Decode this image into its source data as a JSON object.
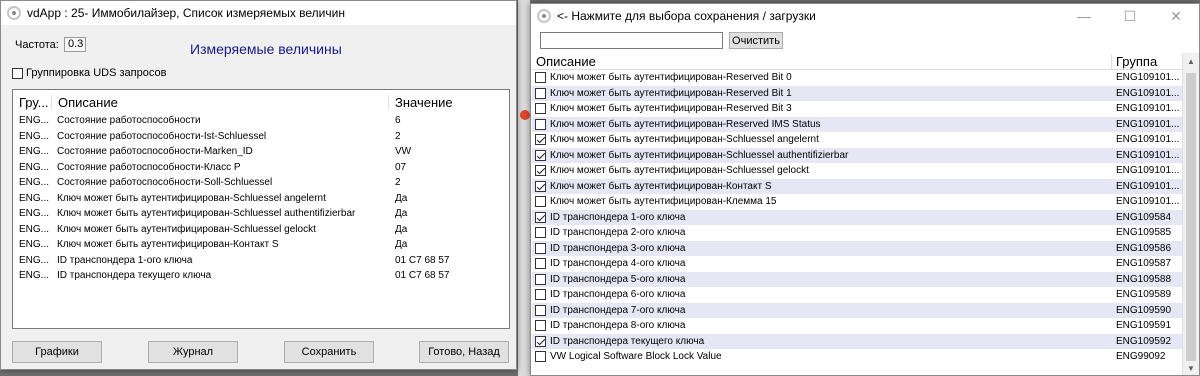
{
  "left_window": {
    "title": "vdApp : 25- Иммобилайзер,  Список измеряемых величин",
    "freq_label": "Частота:",
    "freq_value": "0.3",
    "main_title": "Измеряемые величины",
    "grouping_label": "Группировка UDS запросов",
    "grouping_checked": false,
    "columns": [
      "Гру...",
      "Описание",
      "Значение"
    ],
    "rows": [
      {
        "group": "ENG...",
        "desc": "Состояние работоспособности",
        "value": "6"
      },
      {
        "group": "ENG...",
        "desc": "Состояние работоспособности-Ist-Schluessel",
        "value": "2"
      },
      {
        "group": "ENG...",
        "desc": "Состояние работоспособности-Marken_ID",
        "value": "VW"
      },
      {
        "group": "ENG...",
        "desc": "Состояние работоспособности-Класс Р",
        "value": "07"
      },
      {
        "group": "ENG...",
        "desc": "Состояние работоспособности-Soll-Schluessel",
        "value": "2"
      },
      {
        "group": "ENG...",
        "desc": "Ключ может быть аутентифицирован-Schluessel angelernt",
        "value": "Да"
      },
      {
        "group": "ENG...",
        "desc": "Ключ может быть аутентифицирован-Schluessel authentifizierbar",
        "value": "Да"
      },
      {
        "group": "ENG...",
        "desc": "Ключ может быть аутентифицирован-Schluessel gelockt",
        "value": "Да"
      },
      {
        "group": "ENG...",
        "desc": "Ключ может быть аутентифицирован-Контакт S",
        "value": "Да"
      },
      {
        "group": "ENG...",
        "desc": "ID транспондера 1-ого ключа",
        "value": "01 C7 68 57"
      },
      {
        "group": "ENG...",
        "desc": "ID транспондера текущего ключа",
        "value": "01 C7 68 57"
      }
    ],
    "buttons": {
      "graphs": "Графики",
      "journal": "Журнал",
      "save": "Сохранить",
      "done": "Готово, Назад"
    }
  },
  "right_window": {
    "title": "<- Нажмите для выбора сохранения / загрузки",
    "search_placeholder": "",
    "clear_label": "Очистить",
    "columns": [
      "Описание",
      "Группа"
    ],
    "rows": [
      {
        "checked": false,
        "desc": "Ключ может быть аутентифицирован-Reserved Bit 0",
        "group": "ENG109101..."
      },
      {
        "checked": false,
        "desc": "Ключ может быть аутентифицирован-Reserved Bit 1",
        "group": "ENG109101..."
      },
      {
        "checked": false,
        "desc": "Ключ может быть аутентифицирован-Reserved Bit 3",
        "group": "ENG109101..."
      },
      {
        "checked": false,
        "desc": "Ключ может быть аутентифицирован-Reserved IMS Status",
        "group": "ENG109101..."
      },
      {
        "checked": true,
        "desc": "Ключ может быть аутентифицирован-Schluessel angelernt",
        "group": "ENG109101..."
      },
      {
        "checked": true,
        "desc": "Ключ может быть аутентифицирован-Schluessel authentifizierbar",
        "group": "ENG109101..."
      },
      {
        "checked": true,
        "desc": "Ключ может быть аутентифицирован-Schluessel gelockt",
        "group": "ENG109101..."
      },
      {
        "checked": true,
        "desc": "Ключ может быть аутентифицирован-Контакт S",
        "group": "ENG109101..."
      },
      {
        "checked": false,
        "desc": "Ключ может быть аутентифицирован-Клемма 15",
        "group": "ENG109101..."
      },
      {
        "checked": true,
        "desc": "ID транспондера 1-ого ключа",
        "group": "ENG109584"
      },
      {
        "checked": false,
        "desc": "ID транспондера 2-ого ключа",
        "group": "ENG109585"
      },
      {
        "checked": false,
        "desc": "ID транспондера 3-ого ключа",
        "group": "ENG109586"
      },
      {
        "checked": false,
        "desc": "ID транспондера 4-ого ключа",
        "group": "ENG109587"
      },
      {
        "checked": false,
        "desc": "ID транспондера 5-ого ключа",
        "group": "ENG109588"
      },
      {
        "checked": false,
        "desc": "ID транспондера 6-ого ключа",
        "group": "ENG109589"
      },
      {
        "checked": false,
        "desc": "ID транспондера 7-ого ключа",
        "group": "ENG109590"
      },
      {
        "checked": false,
        "desc": "ID транспондера 8-ого ключа",
        "group": "ENG109591"
      },
      {
        "checked": true,
        "desc": "ID транспондера текущего ключа",
        "group": "ENG109592"
      },
      {
        "checked": false,
        "desc": "VW Logical Software Block Lock Value",
        "group": "ENG99092"
      }
    ]
  },
  "colors": {
    "title_accent": "#1a1a8a",
    "alt_row": "#e6e6f5",
    "window_bg": "#f0f0f0"
  }
}
